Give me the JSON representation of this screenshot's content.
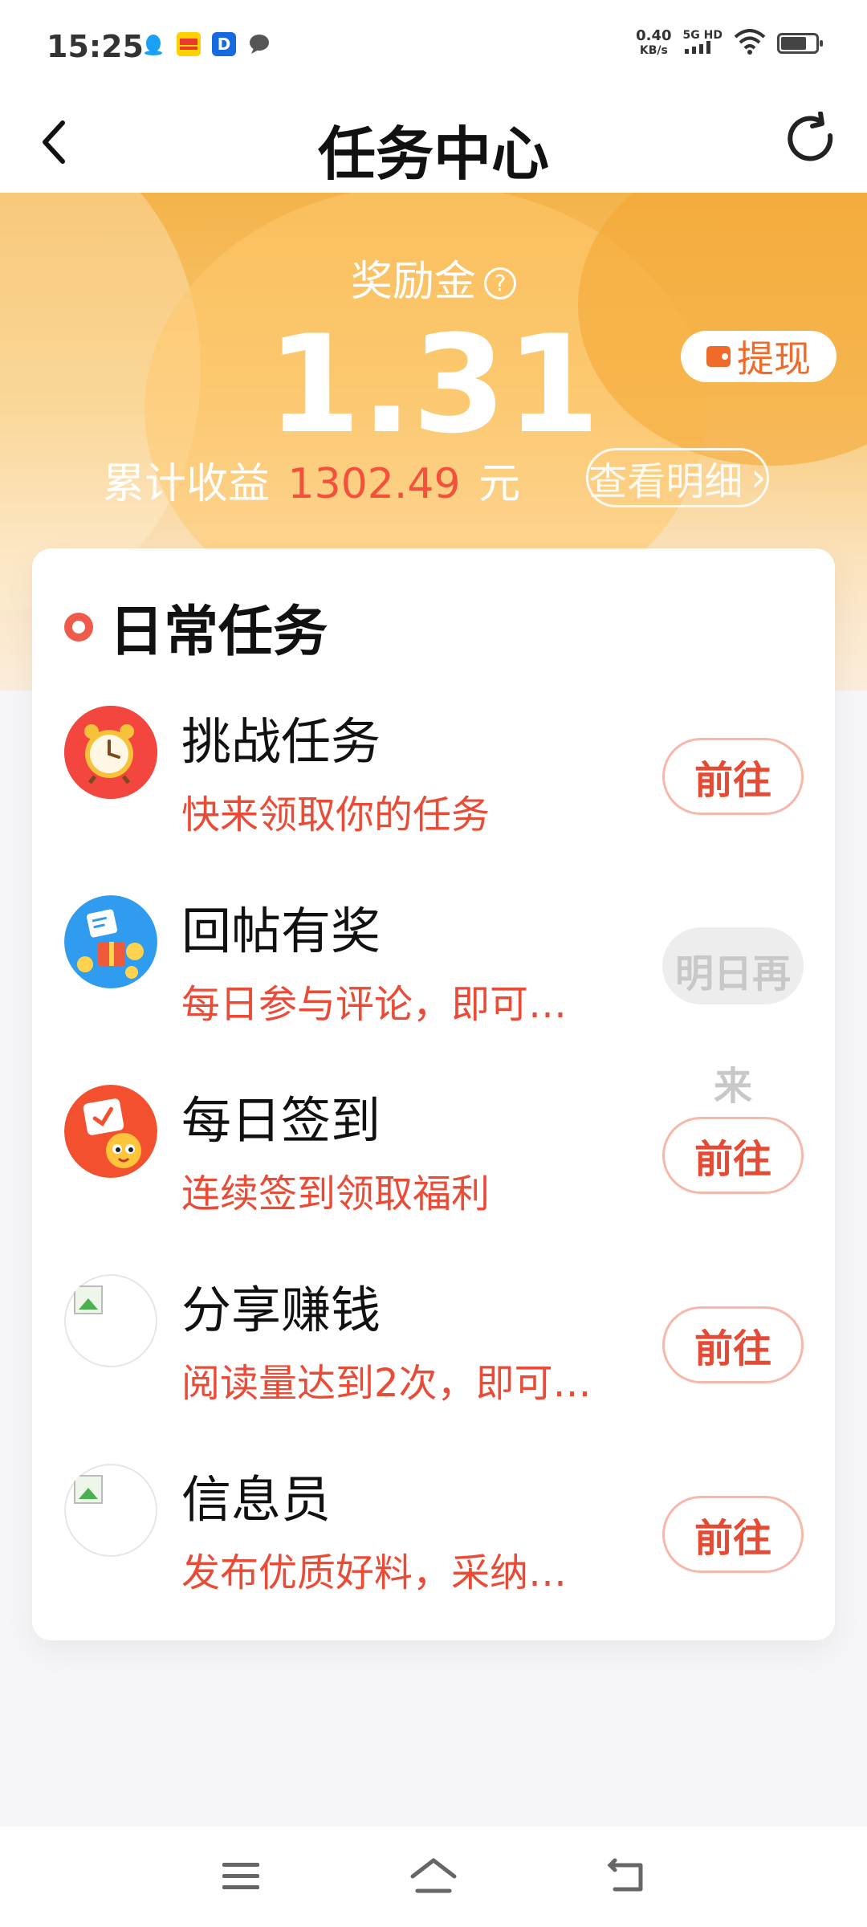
{
  "status_bar": {
    "time": "15:25",
    "net_speed": "0.40",
    "net_speed_unit": "KB/s",
    "network": "5G HD",
    "app_icons": [
      "qq-icon",
      "meituan-icon",
      "d-app-icon",
      "message-icon"
    ],
    "battery_level": 0.7
  },
  "header": {
    "title": "任务中心",
    "back_icon": "chevron-left-icon",
    "refresh_icon": "refresh-icon"
  },
  "hero": {
    "label": "奖励金",
    "help_icon": "?",
    "amount": "1.31",
    "withdraw_label": "提现",
    "total_prefix": "累计收益",
    "total_value": "1302.49",
    "total_unit": "元",
    "detail_label": "查看明细",
    "detail_arrow": "›"
  },
  "daily": {
    "title": "日常任务",
    "tasks": [
      {
        "title": "挑战任务",
        "desc": "快来领取你的任务",
        "button": "前往",
        "icon": "alarm-clock-icon",
        "disabled": false
      },
      {
        "title": "回帖有奖",
        "desc": "每日参与评论，即可…",
        "button": "明日再来",
        "button_line1": "明日再",
        "button_line2": "来",
        "icon": "reply-gift-icon",
        "disabled": true
      },
      {
        "title": "每日签到",
        "desc": "连续签到领取福利",
        "button": "前往",
        "icon": "calendar-checkin-icon",
        "disabled": false
      },
      {
        "title": "分享赚钱",
        "desc": "阅读量达到2次，即可…",
        "button": "前往",
        "icon": "broken-image-icon",
        "disabled": false
      },
      {
        "title": "信息员",
        "desc": "发布优质好料，采纳…",
        "button": "前往",
        "icon": "broken-image-icon",
        "disabled": false
      }
    ]
  },
  "colors": {
    "accent": "#e54a35",
    "hero_orange": "#f4b34a",
    "withdraw": "#f06a2a"
  },
  "nav_bar": [
    "menu-icon",
    "home-icon",
    "back-icon"
  ]
}
